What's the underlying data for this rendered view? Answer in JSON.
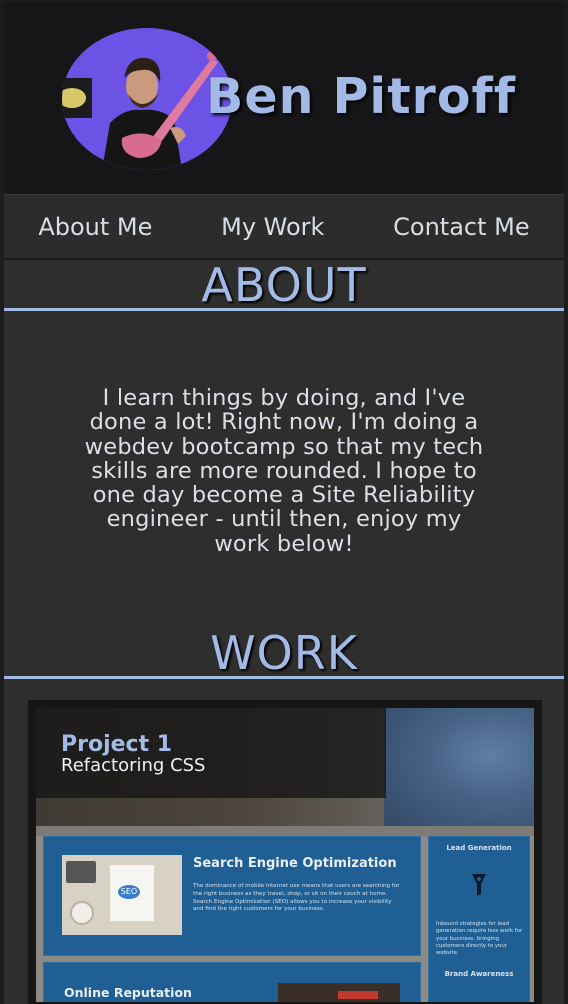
{
  "header": {
    "name": "Ben Pitroff"
  },
  "nav": {
    "items": [
      "About Me",
      "My Work",
      "Contact Me"
    ]
  },
  "about": {
    "heading": "ABOUT",
    "lines": [
      "I learn things by doing, and I've",
      "done a lot! Right now, I'm doing a",
      "webdev bootcamp so that my tech",
      "skills are more rounded. I hope to",
      "one day become a Site Reliability",
      "engineer - until then, enjoy my",
      "work below!"
    ]
  },
  "work": {
    "heading": "WORK",
    "projects": [
      {
        "title": "Project 1",
        "subtitle": "Refactoring CSS",
        "screenshot": {
          "seo_title": "Search Engine Optimization",
          "seo_text": "The dominance of mobile internet use means that users are searching for the right business as they travel, shop, or sit on their couch at home. Search Engine Optimization (SEO) allows you to increase your visibility and find the right customers for your business.",
          "seo_badge": "SEO",
          "side_title": "Lead Generation",
          "side_text": "Inbound strategies for lead generation require less work for your business, bringing customers directly to your website.",
          "side_title2": "Brand Awareness",
          "rep_title": "Online Reputation"
        }
      }
    ]
  },
  "icons": {
    "avatar": "profile-photo",
    "lead_icon": "funnel-icon"
  },
  "colors": {
    "accent": "#a3b9e6",
    "background": "#2e2e2e",
    "header_bg": "#161618",
    "text": "#dcdfe6"
  }
}
